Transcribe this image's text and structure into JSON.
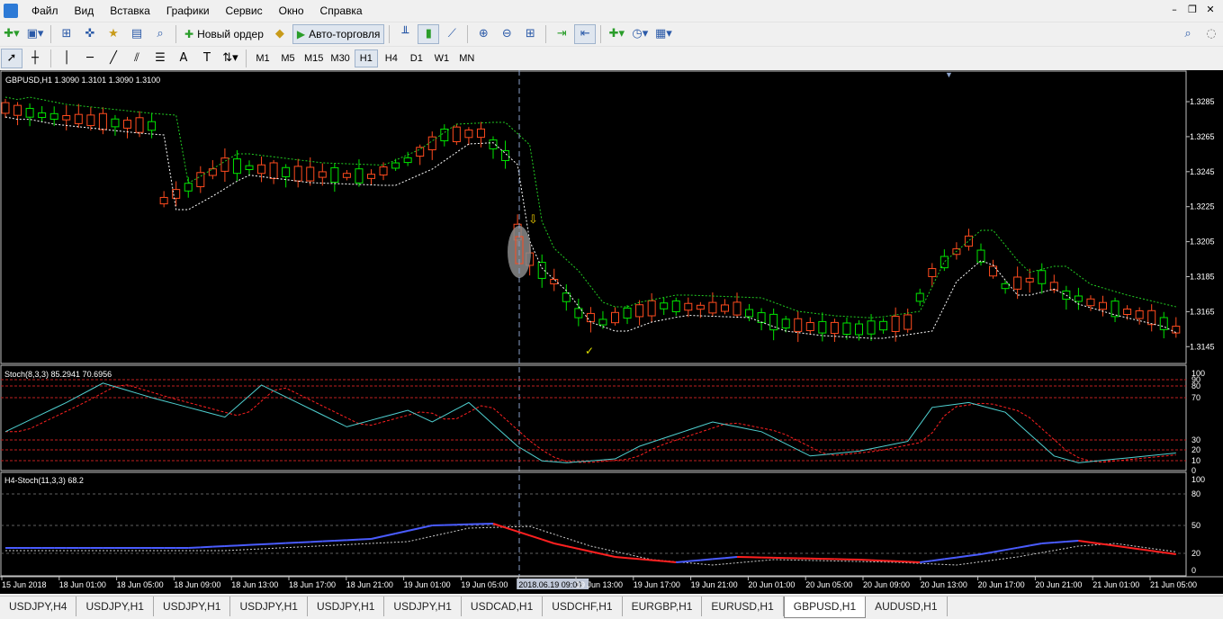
{
  "menu": [
    "Файл",
    "Вид",
    "Вставка",
    "Графики",
    "Сервис",
    "Окно",
    "Справка"
  ],
  "window_buttons": [
    "–",
    "❐",
    "✕"
  ],
  "toolbar": {
    "new_order": "Новый ордер",
    "autotrading": "Авто-торговля"
  },
  "timeframes": [
    "M1",
    "M5",
    "M15",
    "M30",
    "H1",
    "H4",
    "D1",
    "W1",
    "MN"
  ],
  "active_timeframe": "H1",
  "main_chart": {
    "header": "GBPUSD,H1  1.3090 1.3101 1.3090 1.3100",
    "price_labels": [
      "1.3285",
      "1.3265",
      "1.3245",
      "1.3225",
      "1.3205",
      "1.3185",
      "1.3165",
      "1.3145"
    ],
    "up_color": "#00e600",
    "down_color": "#ff4b1e",
    "band_color": "#22cc22",
    "band2_color": "#ffffff"
  },
  "stoch_panel": {
    "header": "Stoch(8,3,3) 85.2941 70.6956",
    "levels": [
      "100",
      "90",
      "80",
      "70",
      "30",
      "20",
      "10",
      "0"
    ],
    "main_color": "#4fd0d0",
    "signal_color": "#ff2020"
  },
  "h4_stoch_panel": {
    "header": "H4-Stoch(11,3,3)  68.2",
    "levels": [
      "100",
      "80",
      "50",
      "20",
      "0"
    ]
  },
  "time_labels": [
    "15 Jun 2018",
    "18 Jun 01:00",
    "18 Jun 05:00",
    "18 Jun 09:00",
    "18 Jun 13:00",
    "18 Jun 17:00",
    "18 Jun 21:00",
    "19 Jun 01:00",
    "19 Jun 05:00",
    "2018.06.19 09:00",
    "19 Jun 13:00",
    "19 Jun 17:00",
    "19 Jun 21:00",
    "20 Jun 01:00",
    "20 Jun 05:00",
    "20 Jun 09:00",
    "20 Jun 13:00",
    "20 Jun 17:00",
    "20 Jun 21:00",
    "21 Jun 01:00",
    "21 Jun 05:00"
  ],
  "crosshair_time": "2018.06.19 09:00",
  "tabs": [
    "USDJPY,H4",
    "USDJPY,H1",
    "USDJPY,H1",
    "USDJPY,H1",
    "USDJPY,H1",
    "USDJPY,H1",
    "USDCAD,H1",
    "USDCHF,H1",
    "EURGBP,H1",
    "EURUSD,H1",
    "GBPUSD,H1",
    "AUDUSD,H1"
  ],
  "active_tab": "GBPUSD,H1"
}
